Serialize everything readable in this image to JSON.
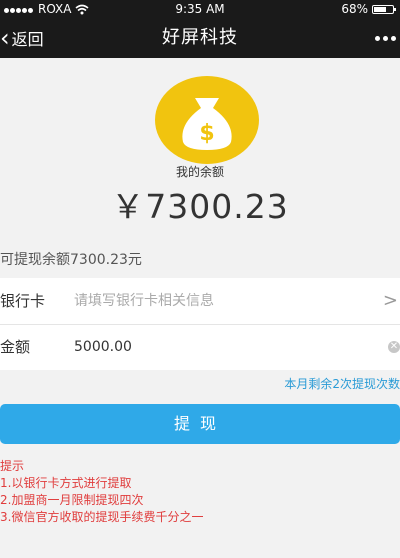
{
  "status_bar": {
    "carrier": "ROXA",
    "time": "9:35 AM",
    "battery": "68%",
    "battery_level": 0.68
  },
  "nav": {
    "back_label": "返回",
    "title": "好屏科技"
  },
  "balance": {
    "label": "我的余额",
    "amount": "￥7300.23"
  },
  "available_text": "可提现余额7300.23元",
  "form": {
    "bank_card": {
      "label": "银行卡",
      "placeholder": "请填写银行卡相关信息",
      "value": ""
    },
    "amount": {
      "label": "金额",
      "value": "5000.00"
    }
  },
  "quota_text": "本月剩余2次提现次数",
  "submit_label": "提现",
  "tips": {
    "title": "提示",
    "items": [
      "1.以银行卡方式进行提取",
      "2.加盟商一月限制提现四次",
      "3.微信官方收取的提现手续费千分之一"
    ]
  },
  "colors": {
    "accent": "#2fa9e8",
    "coin": "#f1c40f",
    "warning": "#e03c3c",
    "nav_bg": "#1a1a1a"
  },
  "icons": {
    "back": "chevron-left-icon",
    "more": "more-dots-icon",
    "bag": "money-bag-icon",
    "arrow": "chevron-right-icon",
    "clear": "clear-icon",
    "wifi": "wifi-icon"
  }
}
